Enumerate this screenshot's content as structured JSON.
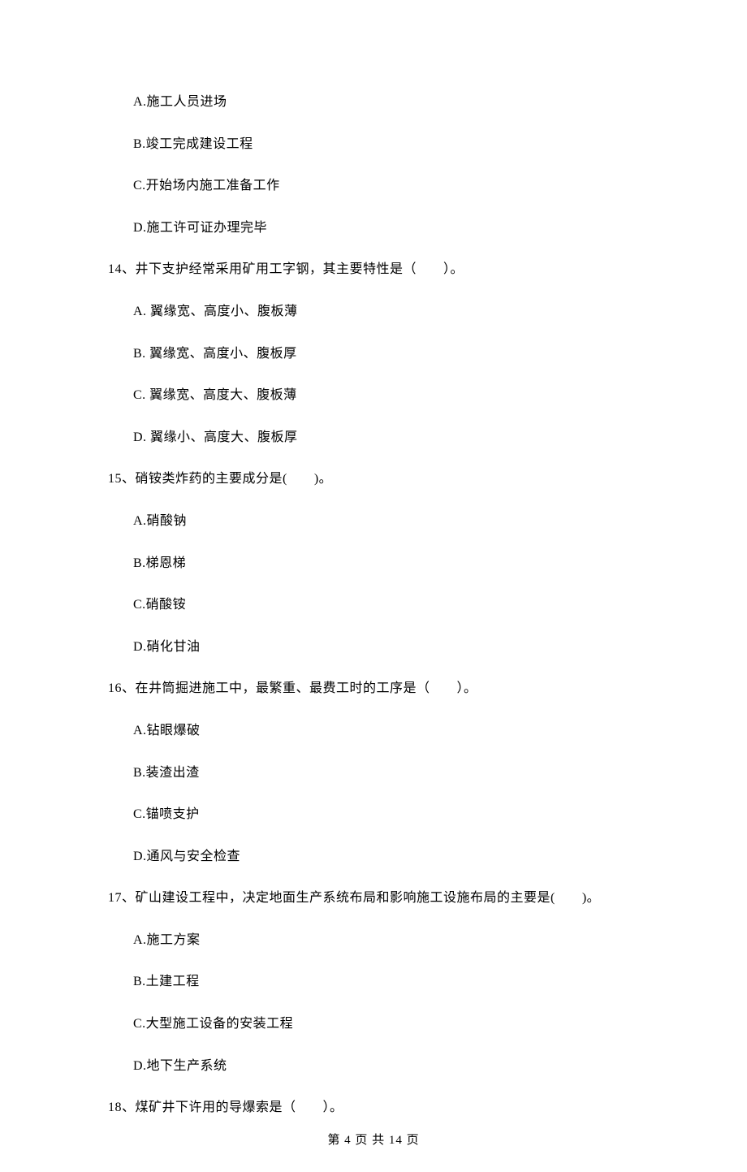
{
  "q13": {
    "options": {
      "A": "A.施工人员进场",
      "B": "B.竣工完成建设工程",
      "C": "C.开始场内施工准备工作",
      "D": "D.施工许可证办理完毕"
    }
  },
  "q14": {
    "text": "14、井下支护经常采用矿用工字钢，其主要特性是（　　）。",
    "options": {
      "A": "A.  翼缘宽、高度小、腹板薄",
      "B": "B.  翼缘宽、高度小、腹板厚",
      "C": "C.  翼缘宽、高度大、腹板薄",
      "D": "D.  翼缘小、高度大、腹板厚"
    }
  },
  "q15": {
    "text": "15、硝铵类炸药的主要成分是(　　)。",
    "options": {
      "A": "A.硝酸钠",
      "B": "B.梯恩梯",
      "C": "C.硝酸铵",
      "D": "D.硝化甘油"
    }
  },
  "q16": {
    "text": "16、在井筒掘进施工中，最繁重、最费工时的工序是（　　）。",
    "options": {
      "A": "A.钻眼爆破",
      "B": "B.装渣出渣",
      "C": "C.锚喷支护",
      "D": "D.通风与安全检查"
    }
  },
  "q17": {
    "text": "17、矿山建设工程中，决定地面生产系统布局和影响施工设施布局的主要是(　　)。",
    "options": {
      "A": "A.施工方案",
      "B": "B.土建工程",
      "C": "C.大型施工设备的安装工程",
      "D": "D.地下生产系统"
    }
  },
  "q18": {
    "text": "18、煤矿井下许用的导爆索是（　　）。"
  },
  "footer": "第 4 页 共 14 页"
}
